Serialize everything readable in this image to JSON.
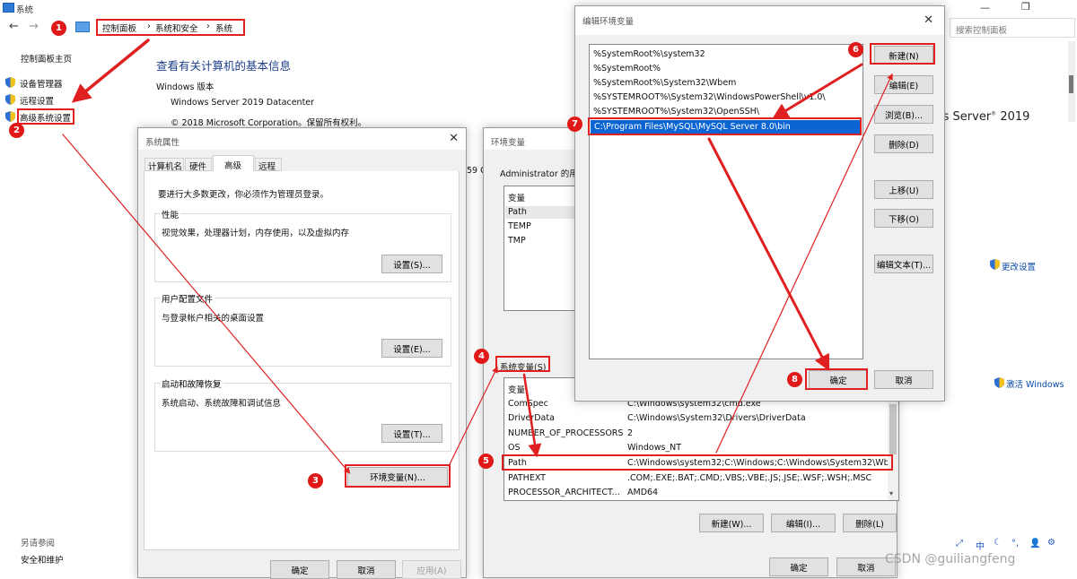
{
  "window": {
    "title": "系统",
    "search_placeholder": "搜索控制面板"
  },
  "breadcrumb": [
    "控制面板",
    "系统和安全",
    "系统"
  ],
  "sidebar": {
    "home": "控制面板主页",
    "items": [
      "设备管理器",
      "远程设置",
      "高级系统设置"
    ],
    "see_also": "另请参阅",
    "security": "安全和维护"
  },
  "main": {
    "title": "查看有关计算机的基本信息",
    "edition_label": "Windows 版本",
    "edition": "Windows Server 2019 Datacenter",
    "copyright": "© 2018 Microsoft Corporation。保留所有权利。",
    "brand": "ws Server",
    "brand_year": "2019",
    "fragment_59": "59 G",
    "change_settings": "更改设置",
    "activate": "激活 Windows"
  },
  "sysprops": {
    "title": "系统属性",
    "tabs": [
      "计算机名",
      "硬件",
      "高级",
      "远程"
    ],
    "admin_note": "要进行大多数更改，你必须作为管理员登录。",
    "perf_title": "性能",
    "perf_desc": "视觉效果，处理器计划，内存使用，以及虚拟内存",
    "settings_btn": "设置(S)...",
    "profile_title": "用户配置文件",
    "profile_desc": "与登录帐户相关的桌面设置",
    "profile_btn": "设置(E)...",
    "startup_title": "启动和故障恢复",
    "startup_desc": "系统启动、系统故障和调试信息",
    "startup_btn": "设置(T)...",
    "envvars_btn": "环境变量(N)...",
    "ok": "确定",
    "cancel": "取消",
    "apply": "应用(A)"
  },
  "envvars": {
    "title": "环境变量",
    "user_section": "Administrator 的用户变量(U)",
    "user_col": "变量",
    "user_vars": [
      "Path",
      "TEMP",
      "TMP"
    ],
    "sys_section": "系统变量(S)",
    "sys_col": "变量",
    "sys_vars": [
      {
        "name": "ComSpec",
        "value": "C:\\Windows\\system32\\cmd.exe"
      },
      {
        "name": "DriverData",
        "value": "C:\\Windows\\System32\\Drivers\\DriverData"
      },
      {
        "name": "NUMBER_OF_PROCESSORS",
        "value": "2"
      },
      {
        "name": "OS",
        "value": "Windows_NT"
      },
      {
        "name": "Path",
        "value": "C:\\Windows\\system32;C:\\Windows;C:\\Windows\\System32\\Wb..."
      },
      {
        "name": "PATHEXT",
        "value": ".COM;.EXE;.BAT;.CMD;.VBS;.VBE;.JS;.JSE;.WSF;.WSH;.MSC"
      },
      {
        "name": "PROCESSOR_ARCHITECT...",
        "value": "AMD64"
      }
    ],
    "new_btn": "新建(W)...",
    "edit_btn": "编辑(I)...",
    "delete_btn": "删除(L)",
    "ok": "确定",
    "cancel": "取消"
  },
  "editenv": {
    "title": "编辑环境变量",
    "entries": [
      "%SystemRoot%\\system32",
      "%SystemRoot%",
      "%SystemRoot%\\System32\\Wbem",
      "%SYSTEMROOT%\\System32\\WindowsPowerShell\\v1.0\\",
      "%SYSTEMROOT%\\System32\\OpenSSH\\",
      "C:\\Program Files\\MySQL\\MySQL Server 8.0\\bin"
    ],
    "buttons": [
      "新建(N)",
      "编辑(E)",
      "浏览(B)...",
      "删除(D)",
      "上移(U)",
      "下移(O)",
      "编辑文本(T)..."
    ],
    "ok": "确定",
    "cancel": "取消"
  },
  "badges": [
    "1",
    "2",
    "3",
    "4",
    "5",
    "6",
    "7",
    "8"
  ],
  "taskbar": {
    "ime": "中"
  },
  "watermark": "CSDN @guiliangfeng",
  "colors": {
    "annotation_red": "#e02020",
    "selection_blue": "#0a64d2",
    "link_blue": "#0b4aa8"
  }
}
